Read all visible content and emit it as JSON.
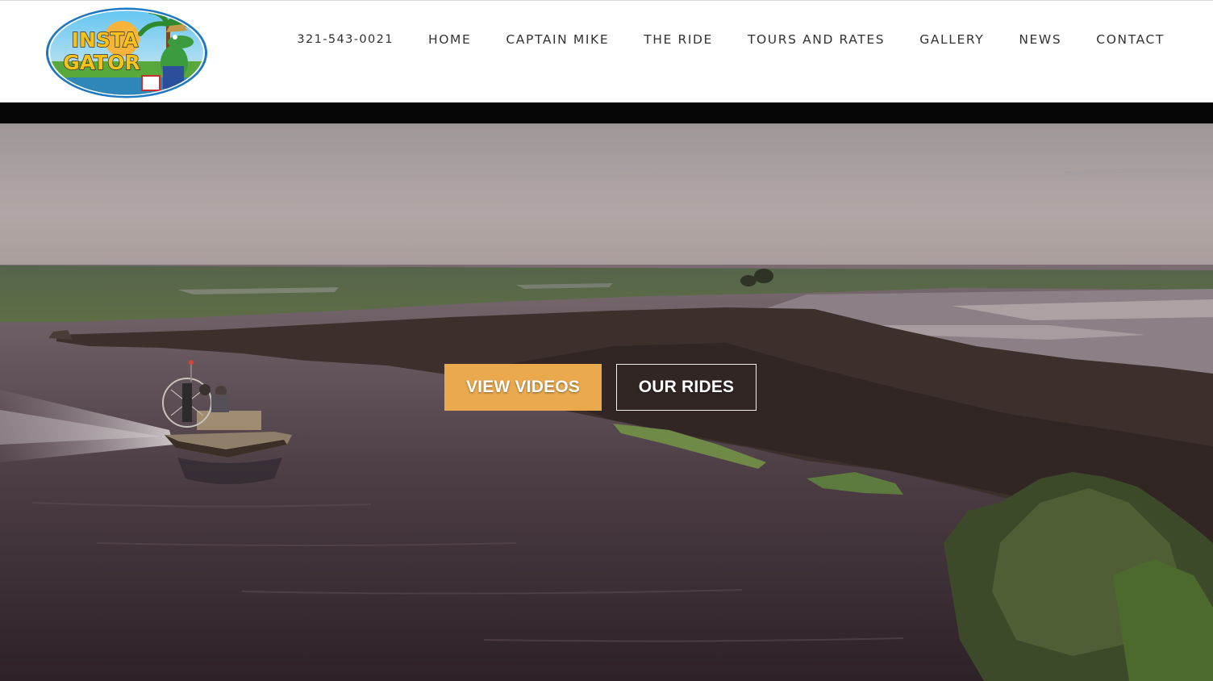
{
  "brand": {
    "logo_line1": "INSTA",
    "logo_line2": "GATOR"
  },
  "nav": {
    "phone": "321-543-0021",
    "items": [
      "HOME",
      "CAPTAIN MIKE",
      "THE RIDE",
      "TOURS AND RATES",
      "GALLERY",
      "NEWS",
      "CONTACT"
    ]
  },
  "hero": {
    "primary_button": "VIEW VIDEOS",
    "secondary_button": "OUR RIDES"
  },
  "colors": {
    "accent": "#e9a94c",
    "nav_text": "#333333",
    "header_bg": "#ffffff",
    "video_band": "#050505"
  }
}
